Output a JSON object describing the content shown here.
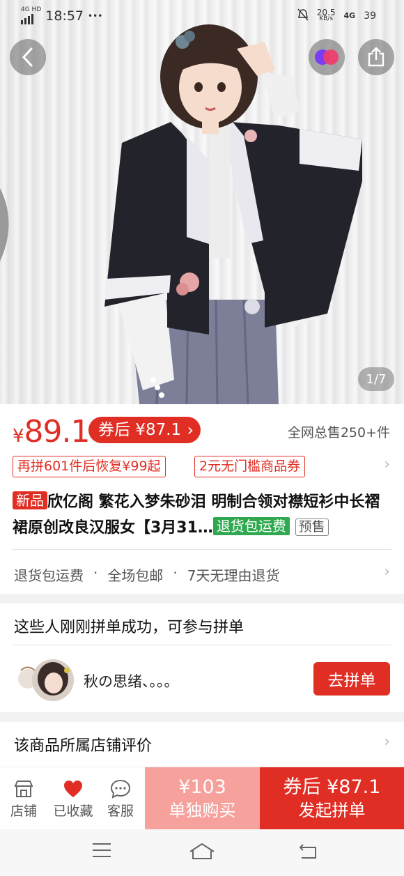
{
  "status_bar": {
    "network": "4G HD",
    "time": "18:57",
    "more": "•••",
    "speed_value": "20.5",
    "speed_unit": "KB/s",
    "net_type": "4G",
    "battery": "39"
  },
  "hero": {
    "image_counter": "1/7"
  },
  "price": {
    "currency": "¥",
    "value": "89.1",
    "coupon_label": "券后 ¥87.1",
    "total_sold": "全网总售250+件"
  },
  "promo_tags": [
    "再拼601件后恢复¥99起",
    "2元无门槛商品券"
  ],
  "title": {
    "new_badge": "新品",
    "text": "欣亿阁 繁花入梦朱砂泪 明制合领对襟短衫中长褶裙原创改良汉服女【3月31…",
    "return_badge": "退货包运费",
    "presale_badge": "预售"
  },
  "services": [
    "退货包运费",
    "·",
    "全场包邮",
    "·",
    "7天无理由退货"
  ],
  "group": {
    "title": "这些人刚刚拼单成功，可参与拼单",
    "member_name": "秋の思绪、。。。",
    "join_button": "去拼单"
  },
  "store_review": {
    "title": "该商品所属店铺评价"
  },
  "bottom_bar": {
    "store": "店铺",
    "favorited": "已收藏",
    "service": "客服",
    "single_price": "¥103",
    "single_label": "单独购买",
    "group_price": "券后 ¥87.1",
    "group_label": "发起拼单"
  },
  "colors": {
    "accent": "#e02e24",
    "accent_light": "#f6a19c",
    "green": "#2fa84f"
  }
}
